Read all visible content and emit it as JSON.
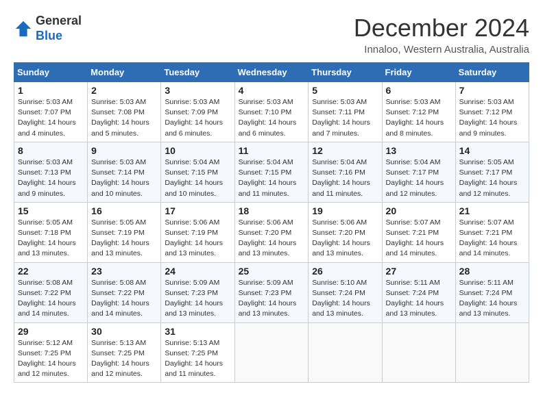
{
  "header": {
    "logo_general": "General",
    "logo_blue": "Blue",
    "month": "December 2024",
    "location": "Innaloo, Western Australia, Australia"
  },
  "weekdays": [
    "Sunday",
    "Monday",
    "Tuesday",
    "Wednesday",
    "Thursday",
    "Friday",
    "Saturday"
  ],
  "weeks": [
    [
      {
        "day": "1",
        "sunrise": "5:03 AM",
        "sunset": "7:07 PM",
        "daylight": "14 hours and 4 minutes."
      },
      {
        "day": "2",
        "sunrise": "5:03 AM",
        "sunset": "7:08 PM",
        "daylight": "14 hours and 5 minutes."
      },
      {
        "day": "3",
        "sunrise": "5:03 AM",
        "sunset": "7:09 PM",
        "daylight": "14 hours and 6 minutes."
      },
      {
        "day": "4",
        "sunrise": "5:03 AM",
        "sunset": "7:10 PM",
        "daylight": "14 hours and 6 minutes."
      },
      {
        "day": "5",
        "sunrise": "5:03 AM",
        "sunset": "7:11 PM",
        "daylight": "14 hours and 7 minutes."
      },
      {
        "day": "6",
        "sunrise": "5:03 AM",
        "sunset": "7:12 PM",
        "daylight": "14 hours and 8 minutes."
      },
      {
        "day": "7",
        "sunrise": "5:03 AM",
        "sunset": "7:12 PM",
        "daylight": "14 hours and 9 minutes."
      }
    ],
    [
      {
        "day": "8",
        "sunrise": "5:03 AM",
        "sunset": "7:13 PM",
        "daylight": "14 hours and 9 minutes."
      },
      {
        "day": "9",
        "sunrise": "5:03 AM",
        "sunset": "7:14 PM",
        "daylight": "14 hours and 10 minutes."
      },
      {
        "day": "10",
        "sunrise": "5:04 AM",
        "sunset": "7:15 PM",
        "daylight": "14 hours and 10 minutes."
      },
      {
        "day": "11",
        "sunrise": "5:04 AM",
        "sunset": "7:15 PM",
        "daylight": "14 hours and 11 minutes."
      },
      {
        "day": "12",
        "sunrise": "5:04 AM",
        "sunset": "7:16 PM",
        "daylight": "14 hours and 11 minutes."
      },
      {
        "day": "13",
        "sunrise": "5:04 AM",
        "sunset": "7:17 PM",
        "daylight": "14 hours and 12 minutes."
      },
      {
        "day": "14",
        "sunrise": "5:05 AM",
        "sunset": "7:17 PM",
        "daylight": "14 hours and 12 minutes."
      }
    ],
    [
      {
        "day": "15",
        "sunrise": "5:05 AM",
        "sunset": "7:18 PM",
        "daylight": "14 hours and 13 minutes."
      },
      {
        "day": "16",
        "sunrise": "5:05 AM",
        "sunset": "7:19 PM",
        "daylight": "14 hours and 13 minutes."
      },
      {
        "day": "17",
        "sunrise": "5:06 AM",
        "sunset": "7:19 PM",
        "daylight": "14 hours and 13 minutes."
      },
      {
        "day": "18",
        "sunrise": "5:06 AM",
        "sunset": "7:20 PM",
        "daylight": "14 hours and 13 minutes."
      },
      {
        "day": "19",
        "sunrise": "5:06 AM",
        "sunset": "7:20 PM",
        "daylight": "14 hours and 13 minutes."
      },
      {
        "day": "20",
        "sunrise": "5:07 AM",
        "sunset": "7:21 PM",
        "daylight": "14 hours and 14 minutes."
      },
      {
        "day": "21",
        "sunrise": "5:07 AM",
        "sunset": "7:21 PM",
        "daylight": "14 hours and 14 minutes."
      }
    ],
    [
      {
        "day": "22",
        "sunrise": "5:08 AM",
        "sunset": "7:22 PM",
        "daylight": "14 hours and 14 minutes."
      },
      {
        "day": "23",
        "sunrise": "5:08 AM",
        "sunset": "7:22 PM",
        "daylight": "14 hours and 14 minutes."
      },
      {
        "day": "24",
        "sunrise": "5:09 AM",
        "sunset": "7:23 PM",
        "daylight": "14 hours and 13 minutes."
      },
      {
        "day": "25",
        "sunrise": "5:09 AM",
        "sunset": "7:23 PM",
        "daylight": "14 hours and 13 minutes."
      },
      {
        "day": "26",
        "sunrise": "5:10 AM",
        "sunset": "7:24 PM",
        "daylight": "14 hours and 13 minutes."
      },
      {
        "day": "27",
        "sunrise": "5:11 AM",
        "sunset": "7:24 PM",
        "daylight": "14 hours and 13 minutes."
      },
      {
        "day": "28",
        "sunrise": "5:11 AM",
        "sunset": "7:24 PM",
        "daylight": "14 hours and 13 minutes."
      }
    ],
    [
      {
        "day": "29",
        "sunrise": "5:12 AM",
        "sunset": "7:25 PM",
        "daylight": "14 hours and 12 minutes."
      },
      {
        "day": "30",
        "sunrise": "5:13 AM",
        "sunset": "7:25 PM",
        "daylight": "14 hours and 12 minutes."
      },
      {
        "day": "31",
        "sunrise": "5:13 AM",
        "sunset": "7:25 PM",
        "daylight": "14 hours and 11 minutes."
      },
      null,
      null,
      null,
      null
    ]
  ]
}
